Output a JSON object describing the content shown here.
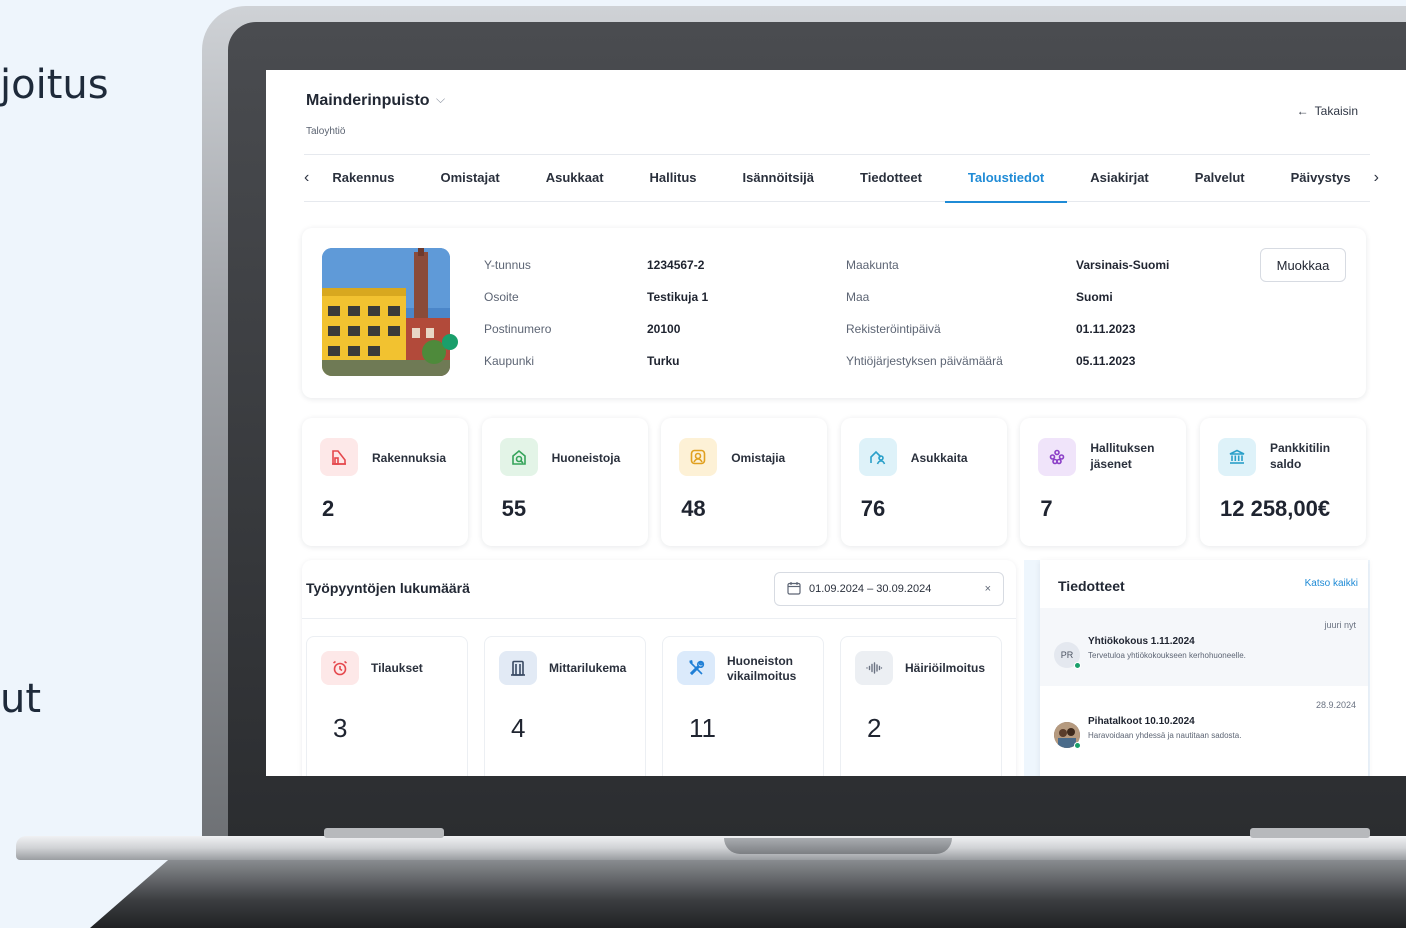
{
  "side": {
    "text1": "joitus",
    "text2": "ut"
  },
  "header": {
    "title": "Mainderinpuisto",
    "subtitle": "Taloyhtiö",
    "back_label": "Takaisin"
  },
  "tabs": [
    "Rakennus",
    "Omistajat",
    "Asukkaat",
    "Hallitus",
    "Isännöitsijä",
    "Tiedotteet",
    "Taloustiedot",
    "Asiakirjat",
    "Palvelut",
    "Päivystys"
  ],
  "active_tab": "Taloustiedot",
  "info": {
    "edit_label": "Muokkaa",
    "left": [
      {
        "label": "Y-tunnus",
        "value": "1234567-2"
      },
      {
        "label": "Osoite",
        "value": "Testikuja 1"
      },
      {
        "label": "Postinumero",
        "value": "20100"
      },
      {
        "label": "Kaupunki",
        "value": "Turku"
      }
    ],
    "right": [
      {
        "label": "Maakunta",
        "value": "Varsinais-Suomi"
      },
      {
        "label": "Maa",
        "value": "Suomi"
      },
      {
        "label": "Rekisteröintipäivä",
        "value": "01.11.2023"
      },
      {
        "label": "Yhtiöjärjestyksen päivämäärä",
        "value": "05.11.2023"
      }
    ]
  },
  "stats": [
    {
      "label": "Rakennuksia",
      "value": "2",
      "icon": "building-icon",
      "color": "#e5484d",
      "bg": "#fde8e8"
    },
    {
      "label": "Huoneistoja",
      "value": "55",
      "icon": "apartment-search-icon",
      "color": "#35a35a",
      "bg": "#e3f4e7"
    },
    {
      "label": "Omistajia",
      "value": "48",
      "icon": "owner-icon",
      "color": "#e0a020",
      "bg": "#fdf1d6"
    },
    {
      "label": "Asukkaita",
      "value": "76",
      "icon": "residents-icon",
      "color": "#2aa0c9",
      "bg": "#def2f9"
    },
    {
      "label": "Hallituksen jäsenet",
      "value": "7",
      "icon": "board-icon",
      "color": "#8b3fc7",
      "bg": "#f0e4fa"
    },
    {
      "label": "Pankkitilin saldo",
      "value": "12 258,00€",
      "icon": "bank-icon",
      "color": "#2aa0c9",
      "bg": "#def2f9"
    }
  ],
  "work_orders": {
    "title": "Työpyyntöjen lukumäärä",
    "date_range": "01.09.2024 – 30.09.2024",
    "clear": "×",
    "items": [
      {
        "label": "Tilaukset",
        "value": "3",
        "icon": "alarm-clock-icon",
        "color": "#e5484d",
        "bg": "#fde8e8"
      },
      {
        "label": "Mittarilukema",
        "value": "4",
        "icon": "meter-icon",
        "color": "#3a4a63",
        "bg": "#e2eaf5"
      },
      {
        "label": "Huoneiston vikailmoitus",
        "value": "11",
        "icon": "tools-icon",
        "color": "#1f7fd6",
        "bg": "#dbeafb"
      },
      {
        "label": "Häiriöilmoitus",
        "value": "2",
        "icon": "sound-wave-icon",
        "color": "#6b7382",
        "bg": "#eceff3"
      }
    ]
  },
  "announcements": {
    "title": "Tiedotteet",
    "see_all": "Katso kaikki",
    "items": [
      {
        "time": "juuri nyt",
        "avatar": "PR",
        "title": "Yhtiökokous 1.11.2024",
        "body": "Tervetuloa yhtiökokoukseen kerhohuoneelle."
      },
      {
        "time": "28.9.2024",
        "avatar": "",
        "title": "Pihatalkoot 10.10.2024",
        "body": "Haravoidaan yhdessä ja nautitaan sadosta."
      }
    ]
  }
}
